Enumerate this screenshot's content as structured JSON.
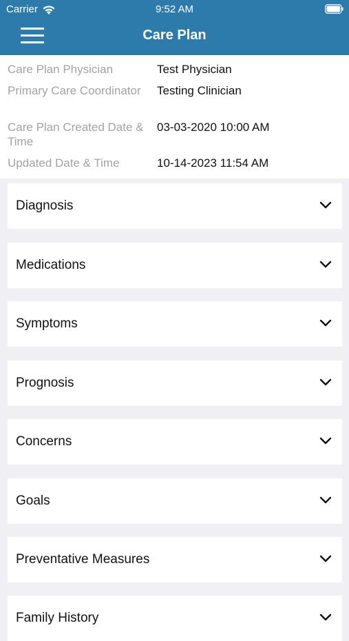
{
  "status_bar": {
    "carrier": "Carrier",
    "time": "9:52 AM"
  },
  "header": {
    "title": "Care Plan"
  },
  "info": {
    "rows": [
      {
        "label": "Care Plan Physician",
        "value": "Test Physician"
      },
      {
        "label": "Primary Care Coordinator",
        "value": "Testing Clinician"
      },
      {
        "label": "Care Plan Created Date & Time",
        "value": "03-03-2020 10:00 AM"
      },
      {
        "label": "Updated Date & Time",
        "value": "10-14-2023 11:54 AM"
      }
    ]
  },
  "sections": [
    {
      "label": "Diagnosis"
    },
    {
      "label": "Medications"
    },
    {
      "label": "Symptoms"
    },
    {
      "label": "Prognosis"
    },
    {
      "label": "Concerns"
    },
    {
      "label": "Goals"
    },
    {
      "label": "Preventative Measures"
    },
    {
      "label": "Family History"
    }
  ],
  "colors": {
    "header_background": "#2c7bab",
    "page_background": "#efeff4",
    "label_gray": "#a2a2a7"
  }
}
